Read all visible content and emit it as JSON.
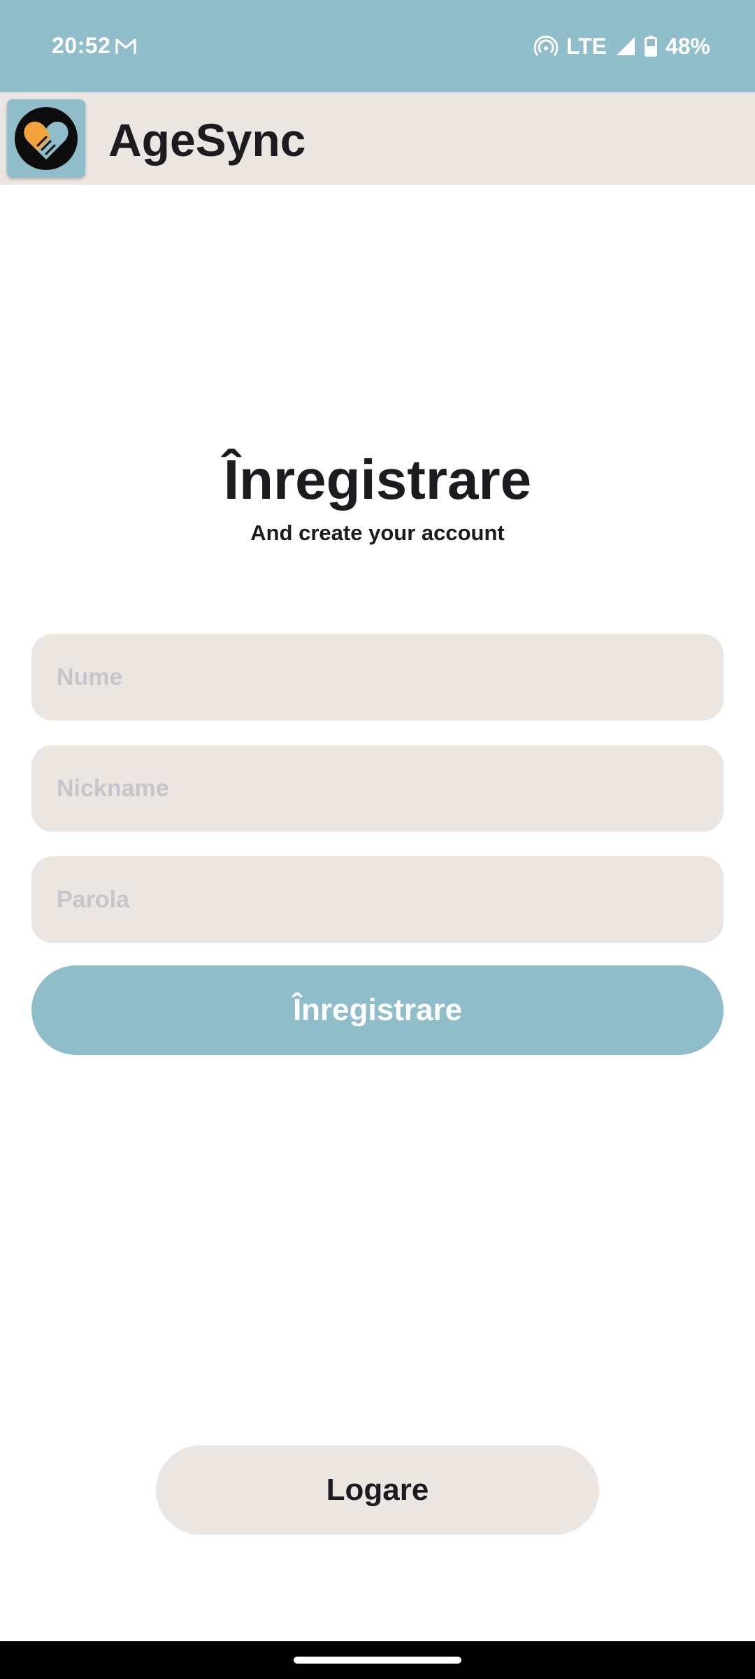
{
  "status_bar": {
    "time": "20:52",
    "network": "LTE",
    "battery": "48%",
    "icons": [
      "gmail-icon",
      "hotspot-icon",
      "signal-icon",
      "battery-icon"
    ]
  },
  "app_bar": {
    "title": "AgeSync",
    "logo_icon": "handshake-heart-icon"
  },
  "screen": {
    "heading": "Înregistrare",
    "subheading": "And create your account"
  },
  "form": {
    "name_placeholder": "Nume",
    "nickname_placeholder": "Nickname",
    "password_placeholder": "Parola",
    "name_value": "",
    "nickname_value": "",
    "password_value": "",
    "register_label": "Înregistrare"
  },
  "footer": {
    "login_label": "Logare"
  },
  "colors": {
    "accent": "#8fbdca",
    "surface": "#ebe6e2",
    "text": "#1c1b1f",
    "placeholder": "#c9c3cc",
    "logo_orange": "#f2a33a"
  }
}
